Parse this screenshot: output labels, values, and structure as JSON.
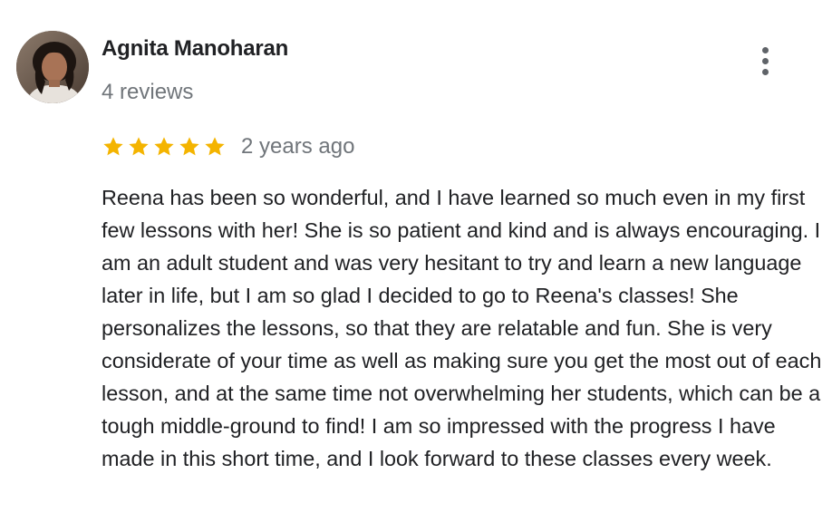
{
  "review": {
    "author": {
      "name": "Agnita Manoharan",
      "review_count": "4 reviews",
      "avatar_icon": "profile-photo"
    },
    "menu_icon": "more-vert-icon",
    "rating": 5,
    "max_rating": 5,
    "star_color": "#f4b400",
    "date": "2 years ago",
    "text": "Reena has been so wonderful, and I have learned so much even in my first few lessons with her! She is so patient and kind and is always encouraging. I am an adult student and was very hesitant to try and learn a new language later in life, but I am so glad I decided to go to Reena's classes! She personalizes the lessons, so that they are relatable and fun. She is very considerate of your time as well as making sure you get the most out of each lesson, and at the same time not overwhelming her students, which can be a tough middle-ground to find! I am so impressed with the progress I have made in this short time, and I look forward to these classes every week."
  }
}
